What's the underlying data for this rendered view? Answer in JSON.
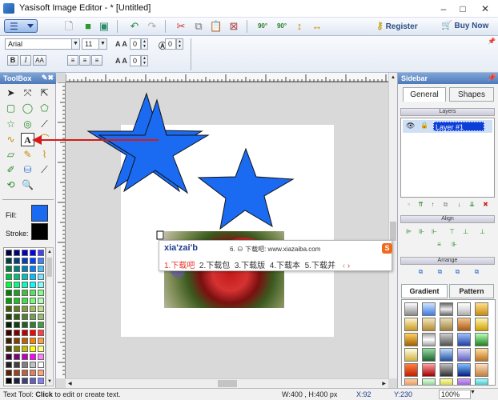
{
  "window": {
    "title": "Yasisoft Image Editor - * [Untitled]",
    "min": "–",
    "max": "□",
    "close": "✕"
  },
  "toolbar": {
    "register": "Register",
    "buy": "Buy Now",
    "rotate_left": "90°",
    "rotate_right": "90°"
  },
  "format": {
    "font": "Arial",
    "size": "11",
    "spacing1": "0",
    "spacing2": "0",
    "spacing3": "0",
    "bold": "B",
    "italic": "I",
    "aa": "AA",
    "aa2": "A A",
    "aa3": "A A"
  },
  "toolbox": {
    "title": "ToolBox",
    "fill_label": "Fill:",
    "stroke_label": "Stroke:",
    "fill_color": "#1a6bf2",
    "stroke_color": "#000000"
  },
  "sidebar": {
    "title": "Sidebar",
    "tabs": [
      "General",
      "Shapes"
    ],
    "layers_title": "Layers",
    "layer_name": "Layer #1",
    "align_title": "Align",
    "arrange_title": "Arrange",
    "fill_tabs": [
      "Gradient",
      "Pattern"
    ]
  },
  "ime": {
    "input": "xia'zai'b",
    "hint": "6. ⊖ 下载吧: www.xiazaiba.com",
    "candidates": [
      "1.下载吧",
      "2.下载包",
      "3.下载版",
      "4.下载本",
      "5.下载并"
    ],
    "logo": "S"
  },
  "status": {
    "tool_prefix": "Text Tool:",
    "tool_bold": "Click",
    "tool_suffix": "to edit or create text.",
    "size": "W:400 , H:400 px",
    "x": "X:92",
    "y": "Y:230",
    "zoom": "100%"
  }
}
